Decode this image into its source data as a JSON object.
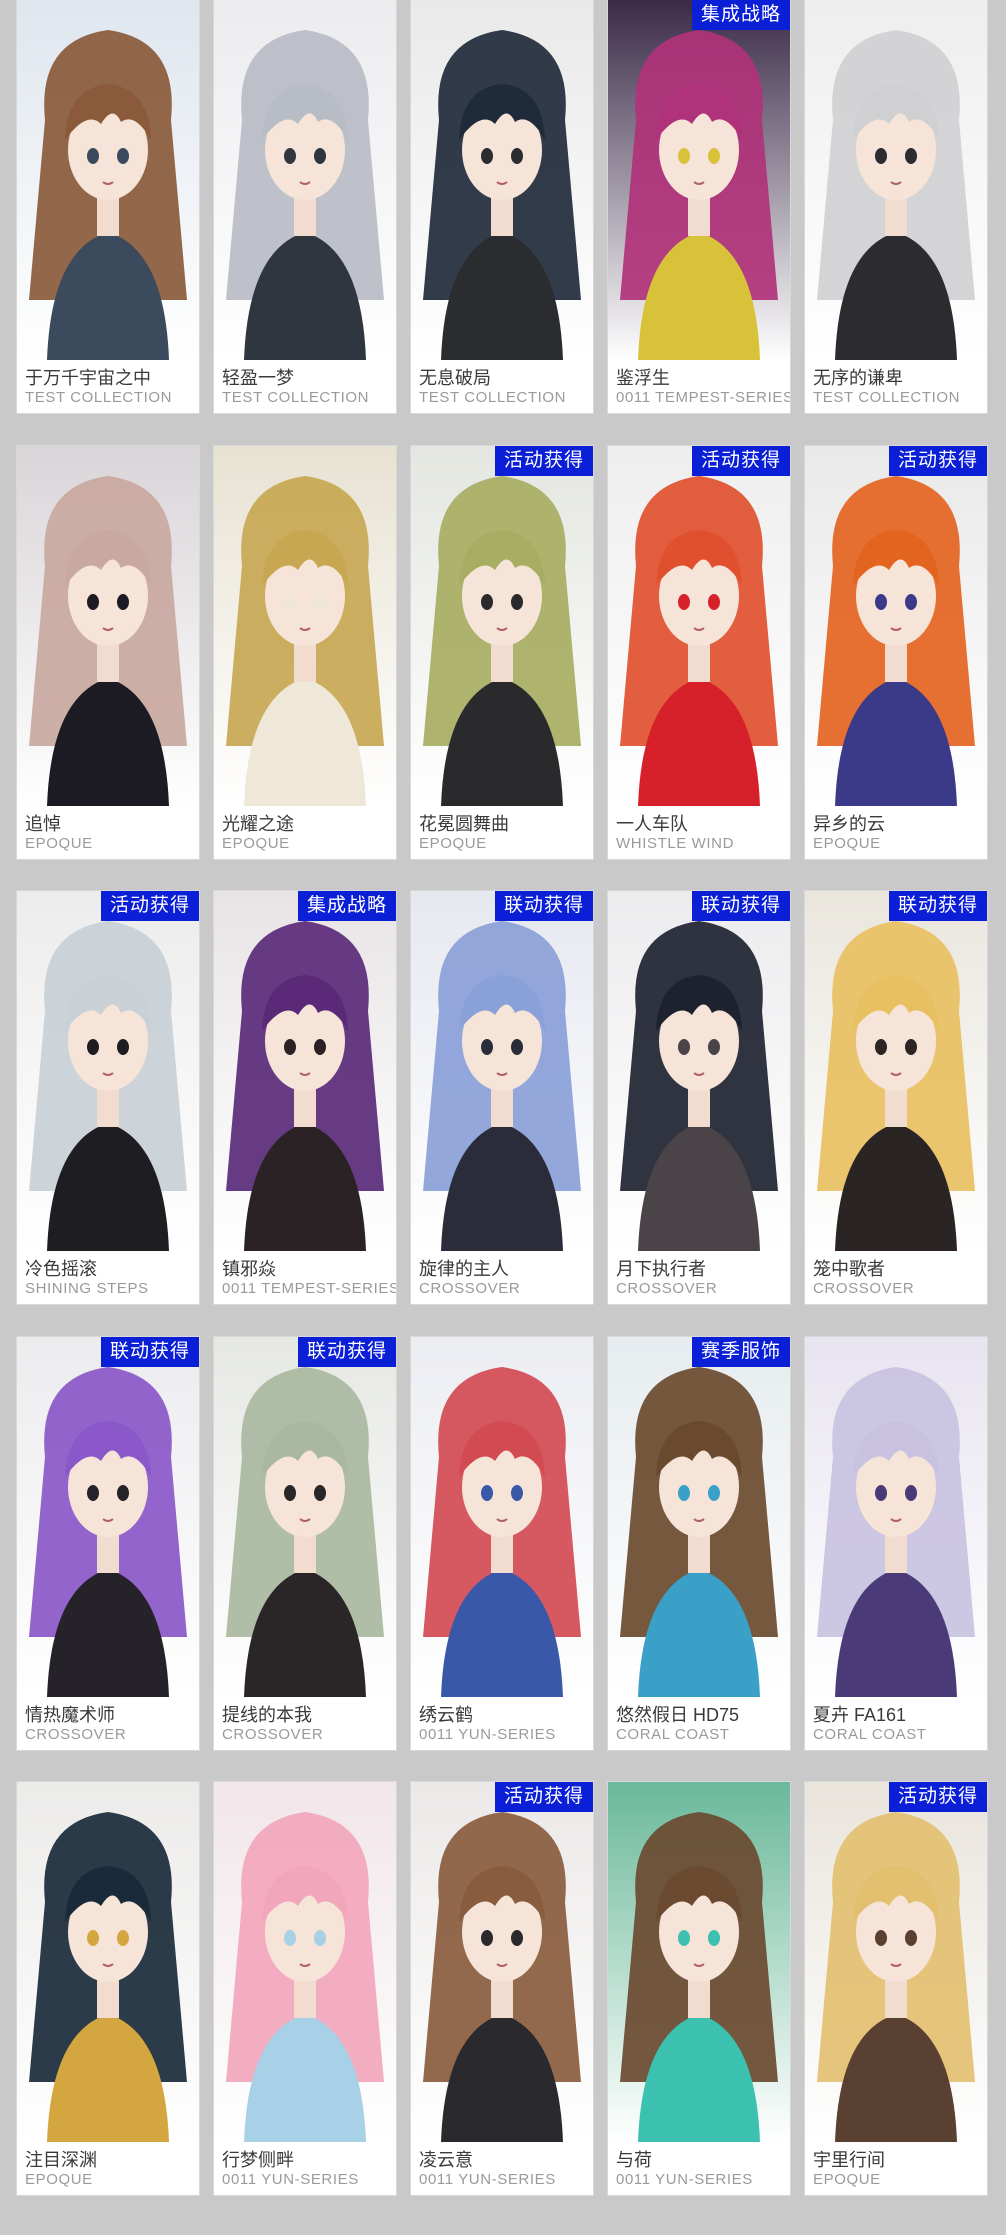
{
  "colors": {
    "background": "#c9c9c9",
    "card": "#ffffff",
    "badge": "#0b1fd6",
    "name_text": "#3a3a3a",
    "series_text": "#9a9a9a"
  },
  "cards": [
    {
      "name": "于万千宇宙之中",
      "series": "TEST COLLECTION",
      "badge": "",
      "palette": [
        "#dfe6ee",
        "#8a5a3a",
        "#3b4a5c"
      ]
    },
    {
      "name": "轻盈一梦",
      "series": "TEST COLLECTION",
      "badge": "",
      "palette": [
        "#ececef",
        "#b8bcc4",
        "#2f3640"
      ]
    },
    {
      "name": "无息破局",
      "series": "TEST COLLECTION",
      "badge": "",
      "palette": [
        "#e9e9ea",
        "#1f2a3a",
        "#2a2c30"
      ]
    },
    {
      "name": "鉴浮生",
      "series": "0011 TEMPEST-SERIES",
      "badge": "集成战略",
      "palette": [
        "#3a2a48",
        "#b0327a",
        "#d8c23a"
      ]
    },
    {
      "name": "无序的谦卑",
      "series": "TEST COLLECTION",
      "badge": "",
      "palette": [
        "#eeeeee",
        "#d0d0d2",
        "#2b2b30"
      ]
    },
    {
      "name": "追悼",
      "series": "EPOQUE",
      "badge": "",
      "palette": [
        "#d9d4d8",
        "#c8a8a0",
        "#1c1a22"
      ]
    },
    {
      "name": "光耀之途",
      "series": "EPOQUE",
      "badge": "",
      "palette": [
        "#e8e2d2",
        "#c7a752",
        "#efe7d8"
      ]
    },
    {
      "name": "花冕圆舞曲",
      "series": "EPOQUE",
      "badge": "活动获得",
      "palette": [
        "#e4e6e0",
        "#a7ad62",
        "#2a2a2c"
      ]
    },
    {
      "name": "一人车队",
      "series": "WHISTLE WIND",
      "badge": "活动获得",
      "palette": [
        "#eeeeee",
        "#e0502e",
        "#d6202a"
      ]
    },
    {
      "name": "异乡的云",
      "series": "EPOQUE",
      "badge": "活动获得",
      "palette": [
        "#e9e9ea",
        "#e3641f",
        "#3a3a88"
      ]
    },
    {
      "name": "冷色摇滚",
      "series": "SHINING STEPS",
      "badge": "活动获得",
      "palette": [
        "#ececec",
        "#c9d0d6",
        "#1e1e22"
      ]
    },
    {
      "name": "镇邪焱",
      "series": "0011 TEMPEST-SERIES",
      "badge": "集成战略",
      "palette": [
        "#e8e4e6",
        "#5a2a78",
        "#2a2224"
      ]
    },
    {
      "name": "旋律的主人",
      "series": "CROSSOVER",
      "badge": "联动获得",
      "palette": [
        "#e6e8f0",
        "#8aa0d8",
        "#2a2c3a"
      ]
    },
    {
      "name": "月下执行者",
      "series": "CROSSOVER",
      "badge": "联动获得",
      "palette": [
        "#ececee",
        "#1e2230",
        "#4a4448"
      ]
    },
    {
      "name": "笼中歌者",
      "series": "CROSSOVER",
      "badge": "联动获得",
      "palette": [
        "#eae6de",
        "#e8c062",
        "#2a2424"
      ]
    },
    {
      "name": "情热魔术师",
      "series": "CROSSOVER",
      "badge": "联动获得",
      "palette": [
        "#ecebee",
        "#8a58c8",
        "#26222a"
      ]
    },
    {
      "name": "提线的本我",
      "series": "CROSSOVER",
      "badge": "联动获得",
      "palette": [
        "#e6e8e4",
        "#aab8a0",
        "#2a2628"
      ]
    },
    {
      "name": "绣云鹤",
      "series": "0011 YUN-SERIES",
      "badge": "",
      "palette": [
        "#ecedf2",
        "#d24a52",
        "#3a58a8"
      ]
    },
    {
      "name": "悠然假日 HD75",
      "series": "CORAL COAST",
      "badge": "赛季服饰",
      "palette": [
        "#e6ecef",
        "#6a4a2e",
        "#3aa0c8"
      ]
    },
    {
      "name": "夏卉 FA161",
      "series": "CORAL COAST",
      "badge": "",
      "palette": [
        "#e8e4f0",
        "#c8c2e0",
        "#4a3a78"
      ]
    },
    {
      "name": "注目深渊",
      "series": "EPOQUE",
      "badge": "",
      "palette": [
        "#ecebea",
        "#1a2a3a",
        "#d4a640"
      ]
    },
    {
      "name": "行梦侧畔",
      "series": "0011 YUN-SERIES",
      "badge": "",
      "palette": [
        "#f1e6ea",
        "#f2a6bc",
        "#a8d0e6"
      ]
    },
    {
      "name": "凌云意",
      "series": "0011 YUN-SERIES",
      "badge": "活动获得",
      "palette": [
        "#ebe9e8",
        "#8a5c3e",
        "#2a2a2e"
      ]
    },
    {
      "name": "与荷",
      "series": "0011 YUN-SERIES",
      "badge": "",
      "palette": [
        "#6ab89a",
        "#6a4a30",
        "#3cc0b0"
      ]
    },
    {
      "name": "宇里行间",
      "series": "EPOQUE",
      "badge": "活动获得",
      "palette": [
        "#e9e4dc",
        "#e2c070",
        "#5a4030"
      ]
    }
  ]
}
